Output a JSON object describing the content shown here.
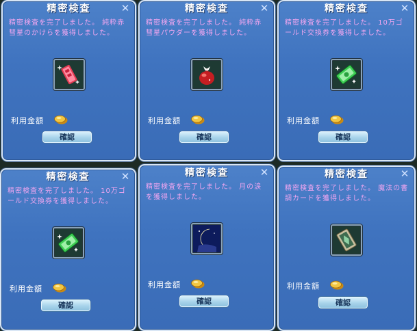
{
  "dialogs": [
    {
      "title": "精密検査",
      "message": "精密検査を完了しました。 純粋赤彗星のかけらを獲得しました。",
      "item_icon": "red-shard-icon",
      "fee_label": "利用金額",
      "ok_label": "確認"
    },
    {
      "title": "精密検査",
      "message": "精密検査を完了しました。 純粋赤彗星パウダーを獲得しました。",
      "item_icon": "red-powder-pouch-icon",
      "fee_label": "利用金額",
      "ok_label": "確認"
    },
    {
      "title": "精密検査",
      "message": "精密検査を完了しました。 10万ゴールド交換券を獲得しました。",
      "item_icon": "gold-voucher-icon",
      "fee_label": "利用金額",
      "ok_label": "確認"
    },
    {
      "title": "精密検査",
      "message": "精密検査を完了しました。 10万ゴールド交換券を獲得しました。",
      "item_icon": "gold-voucher-icon",
      "fee_label": "利用金額",
      "ok_label": "確認"
    },
    {
      "title": "精密検査",
      "message": "精密検査を完了しました。 月の涙を獲得しました。",
      "item_icon": "moon-tear-icon",
      "fee_label": "利用金額",
      "ok_label": "確認"
    },
    {
      "title": "精密検査",
      "message": "精密検査を完了しました。 魔法の書調カードを獲得しました。",
      "item_icon": "magic-card-icon",
      "fee_label": "利用金額",
      "ok_label": "確認"
    }
  ],
  "icons": {
    "close": "close-icon",
    "coin": "gold-coin-icon"
  },
  "colors": {
    "dialog_bg": "#3f73bf",
    "message_text": "#f0a6f0",
    "button_bg": "#a8d3ea"
  }
}
